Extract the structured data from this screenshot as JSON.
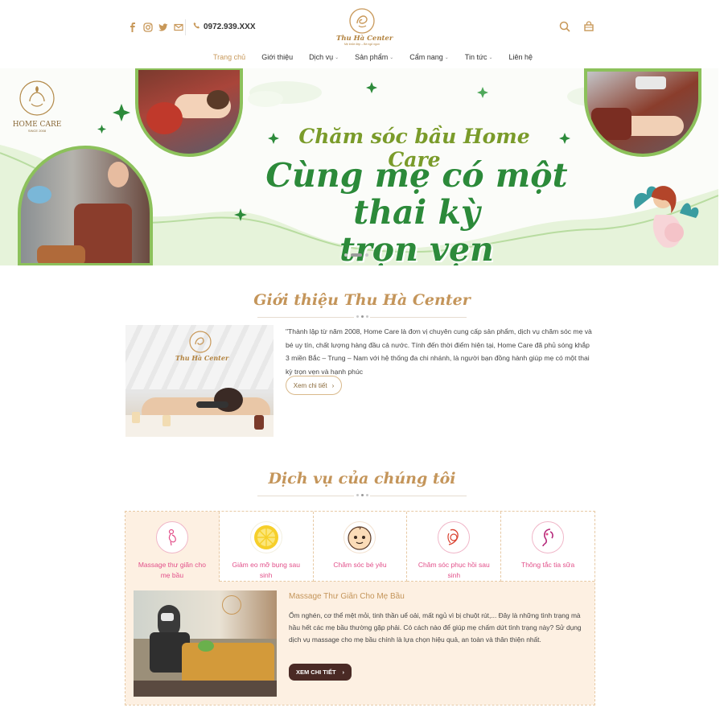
{
  "header": {
    "phone": "0972.939.XXX",
    "logo_name": "Thu Hà Center",
    "logo_tagline": "Mẹ khỏe đẹp – Bé ngủ ngon",
    "social": [
      "facebook-icon",
      "instagram-icon",
      "twitter-icon",
      "mail-icon"
    ]
  },
  "nav": {
    "items": [
      {
        "label": "Trang chủ",
        "has_dropdown": false,
        "active": true
      },
      {
        "label": "Giới thiệu",
        "has_dropdown": false
      },
      {
        "label": "Dịch vụ",
        "has_dropdown": true
      },
      {
        "label": "Sản phẩm",
        "has_dropdown": true
      },
      {
        "label": "Cẩm nang",
        "has_dropdown": true
      },
      {
        "label": "Tin tức",
        "has_dropdown": true
      },
      {
        "label": "Liên hệ",
        "has_dropdown": false
      }
    ]
  },
  "hero": {
    "brand_name": "HOME CARE",
    "brand_since": "SINCE 2008",
    "subtitle": "Chăm sóc bầu Home Care",
    "title_line1": "Cùng mẹ có một thai kỳ",
    "title_line2": "trọn vẹn",
    "slide_count": 3,
    "active_slide": 2
  },
  "intro": {
    "title": "Giới thiệu Thu Hà Center",
    "text": "\"Thành lập từ năm 2008, Home Care là đơn vị chuyên cung cấp sản phẩm, dịch vụ chăm sóc mẹ và bé uy tín, chất lượng hàng đầu cả nước. Tính đến thời điểm hiện tại, Home Care đã phủ sóng khắp 3 miền Bắc – Trung – Nam với hệ thống đa chi nhánh, là người bạn đồng hành giúp mẹ có một thai kỳ trọn vẹn và hạnh phúc",
    "button": "Xem chi tiết",
    "image_logo": "Thu Hà Center"
  },
  "services": {
    "title": "Dịch vụ của chúng tôi",
    "tabs": [
      {
        "label": "Massage thư giãn cho mẹ bầu",
        "icon": "pregnant-icon",
        "active": true
      },
      {
        "label": "Giảm eo mỡ bụng sau sinh",
        "icon": "lemon-icon"
      },
      {
        "label": "Chăm sóc bé yêu",
        "icon": "baby-face-icon"
      },
      {
        "label": "Chăm sóc phục hồi sau sinh",
        "icon": "mother-baby-icon"
      },
      {
        "label": "Thông tắc tia sữa",
        "icon": "woman-profile-icon"
      }
    ],
    "detail": {
      "title": "Massage Thư Giãn Cho Mẹ Bầu",
      "text": "Ốm nghén, cơ thể mệt mỏi, tinh thần uể oải, mất ngủ vì bị chuột rút,... Đây là những tình trạng mà hầu hết các mẹ bầu thường gặp phải. Có cách nào để giúp mẹ chấm dứt tình trạng này? Sử dụng dịch vụ massage cho mẹ bầu chính là lựa chọn hiệu quả, an toàn và thân thiện nhất.",
      "button": "XEM CHI TIẾT"
    }
  },
  "colors": {
    "gold": "#c4955a",
    "green": "#2c8a3a",
    "pink": "#e2508a",
    "peach": "#fdf0e2",
    "dark_button": "#4a2a25"
  }
}
